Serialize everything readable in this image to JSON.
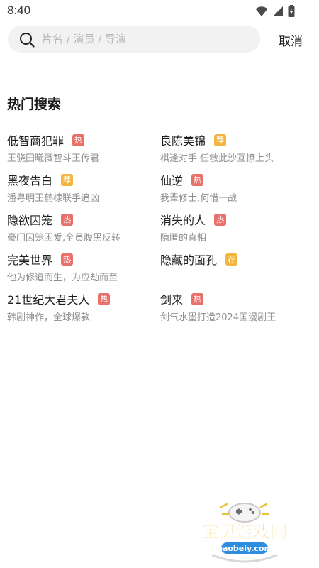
{
  "status": {
    "time": "8:40"
  },
  "search": {
    "placeholder": "片名 / 演员 / 导演",
    "cancel_label": "取消"
  },
  "hot_section": {
    "title": "热门搜索",
    "items": [
      {
        "title": "低智商犯罪",
        "badge": "热",
        "badge_type": "hot",
        "desc": "王骁田曦薇智斗王传君"
      },
      {
        "title": "良陈美锦",
        "badge": "荐",
        "badge_type": "rec",
        "desc": "棋逢对手 任敏此沙互撩上头"
      },
      {
        "title": "黑夜告白",
        "badge": "荐",
        "badge_type": "rec",
        "desc": "潘粤明王鹤棣联手追凶"
      },
      {
        "title": "仙逆",
        "badge": "热",
        "badge_type": "hot",
        "desc": "我辈修士,何惜一战"
      },
      {
        "title": "隐欲囚笼",
        "badge": "热",
        "badge_type": "hot",
        "desc": "豪门囚笼困爱,全员腹黑反转"
      },
      {
        "title": "消失的人",
        "badge": "热",
        "badge_type": "hot",
        "desc": "隐匿的真相"
      },
      {
        "title": "完美世界",
        "badge": "热",
        "badge_type": "hot",
        "desc": "他为修道而生，为应劫而至"
      },
      {
        "title": "隐藏的面孔",
        "badge": "荐",
        "badge_type": "rec",
        "desc": ""
      },
      {
        "title": "21世纪大君夫人",
        "badge": "热",
        "badge_type": "hot",
        "desc": "韩剧神作，全球爆款"
      },
      {
        "title": "剑来",
        "badge": "热",
        "badge_type": "hot",
        "desc": "剑气水墨打造2024国漫剧王"
      }
    ]
  },
  "watermark": {
    "name": "宝贝游戏网",
    "url": "baobeiy.com"
  },
  "colors": {
    "hot_badge": "#e8706b",
    "rec_badge": "#f3b53f",
    "search_bg": "#f2f2f2"
  }
}
